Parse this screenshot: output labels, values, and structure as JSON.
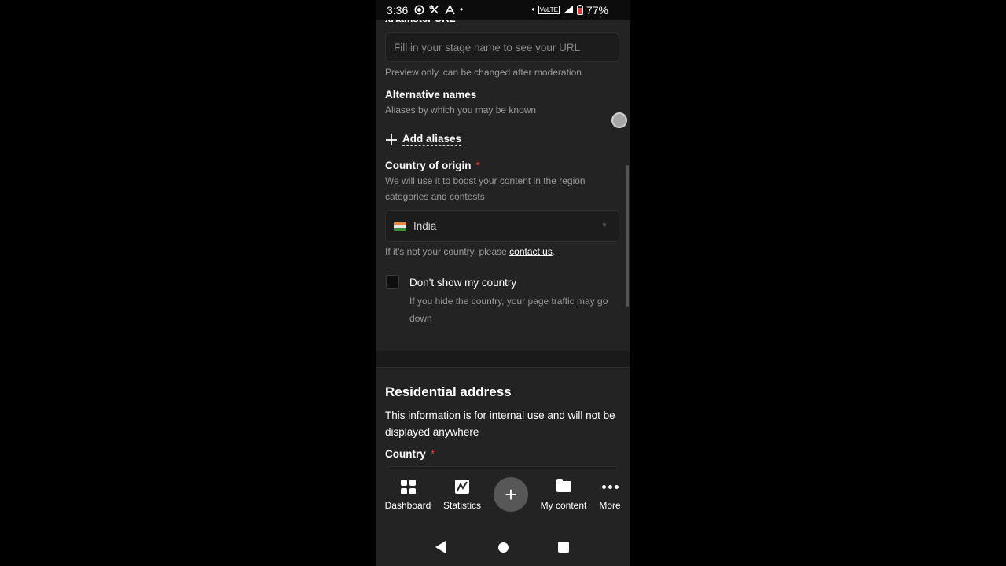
{
  "status_bar": {
    "time": "3:36",
    "volte": "VoLTE",
    "battery": "77%"
  },
  "form": {
    "url_label_partial": "xHamster URL *",
    "url_placeholder": "Fill in your stage name to see your URL",
    "url_hint": "Preview only, can be changed after moderation",
    "alt_names_label": "Alternative names",
    "alt_names_hint": "Aliases by which you may be known",
    "add_aliases": "Add aliases",
    "origin_label": "Country of origin",
    "required_mark": "*",
    "origin_hint": "We will use it to boost your content in the region categories and contests",
    "origin_value": "India",
    "not_your_country": "If it's not your country, please",
    "contact_us": "contact us",
    "period": ".",
    "hide_country_label": "Don't show my country",
    "hide_country_hint": "If you hide the country, your page traffic may go down"
  },
  "residential": {
    "title": "Residential address",
    "description": "This information is for internal use and will not be displayed anywhere",
    "country_label": "Country"
  },
  "bottom_nav": {
    "dashboard": "Dashboard",
    "statistics": "Statistics",
    "add": "+",
    "my_content": "My content",
    "more": "More"
  },
  "colors": {
    "background": "#232323",
    "required": "#e03b3b",
    "fab": "#575757"
  }
}
